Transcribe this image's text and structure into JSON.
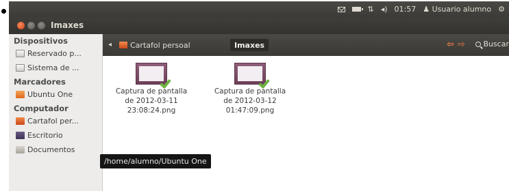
{
  "top_panel": {
    "clock": "01:57",
    "user": "Usuario alumno",
    "icons": [
      "mail-icon",
      "battery-icon",
      "network-icon",
      "volume-icon",
      "user-icon",
      "gear-icon"
    ]
  },
  "window": {
    "title": "Imaxes"
  },
  "toolbar": {
    "breadcrumbs": [
      "Cartafol persoal",
      "Imaxes"
    ],
    "search_label": "Buscar"
  },
  "sidebar": {
    "sections": [
      {
        "heading": "Dispositivos",
        "items": [
          "Reservado p...",
          "Sistema de ..."
        ]
      },
      {
        "heading": "Marcadores",
        "items": [
          "Ubuntu One"
        ]
      },
      {
        "heading": "Computador",
        "items": [
          "Cartafol per...",
          "Escritorio",
          "Documentos"
        ]
      }
    ]
  },
  "files": [
    {
      "line1": "Captura de pantalla",
      "line2": "de 2012-03-11",
      "line3": "23:08:24.png"
    },
    {
      "line1": "Captura de pantalla",
      "line2": "de 2012-03-12",
      "line3": "01:47:09.png"
    }
  ],
  "tooltip": "/home/alumno/Ubuntu One",
  "colors": {
    "accent": "#f07d45",
    "panel_dark": "#3c3b37",
    "check_green": "#6db33f"
  }
}
